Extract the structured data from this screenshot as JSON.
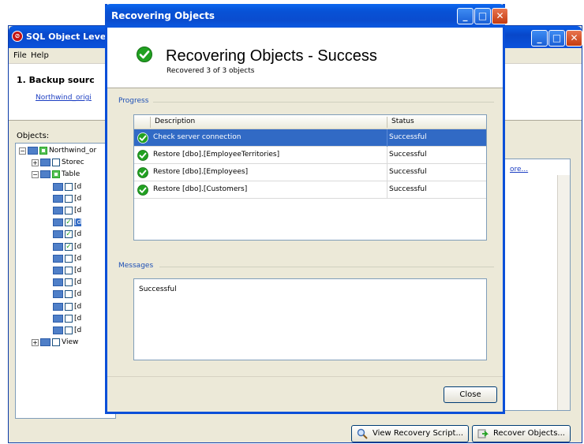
{
  "background_window": {
    "title": "SQL Object Leve",
    "logo": "app-logo-icon",
    "menu": [
      "File",
      "Help"
    ],
    "step_title": "1. Backup sourc",
    "step_link": "Northwind_origi",
    "objects_label": "Objects:",
    "tree": [
      {
        "text": "Northwind_or",
        "level": 0,
        "expander": "-",
        "checked": "green"
      },
      {
        "text": "Storec",
        "level": 1,
        "expander": "+",
        "checked": "none"
      },
      {
        "text": "Table",
        "level": 1,
        "expander": "-",
        "checked": "green"
      },
      {
        "text": "[d",
        "level": 2,
        "checked": "none"
      },
      {
        "text": "[d",
        "level": 2,
        "checked": "none"
      },
      {
        "text": "[d",
        "level": 2,
        "checked": "none"
      },
      {
        "text": "[d",
        "level": 2,
        "checked": "checked",
        "selected": true
      },
      {
        "text": "[d",
        "level": 2,
        "checked": "checked"
      },
      {
        "text": "[d",
        "level": 2,
        "checked": "checked"
      },
      {
        "text": "[d",
        "level": 2,
        "checked": "none"
      },
      {
        "text": "[d",
        "level": 2,
        "checked": "none"
      },
      {
        "text": "[d",
        "level": 2,
        "checked": "none"
      },
      {
        "text": "[d",
        "level": 2,
        "checked": "none"
      },
      {
        "text": "[d",
        "level": 2,
        "checked": "none"
      },
      {
        "text": "[d",
        "level": 2,
        "checked": "none"
      },
      {
        "text": "[d",
        "level": 2,
        "checked": "none"
      },
      {
        "text": "View",
        "level": 1,
        "expander": "+",
        "checked": "none"
      }
    ],
    "more_link": "ore...",
    "buttons": {
      "view_script": "View Recovery Script...",
      "recover": "Recover Objects..."
    }
  },
  "dialog": {
    "title": "Recovering Objects",
    "heading": "Recovering Objects - Success",
    "subheading": "Recovered 3 of 3 objects",
    "progress_label": "Progress",
    "columns": [
      "Description",
      "Status"
    ],
    "rows": [
      {
        "description": "Check server connection",
        "status": "Successful",
        "selected": true
      },
      {
        "description": "Restore [dbo].[EmployeeTerritories]",
        "status": "Successful"
      },
      {
        "description": "Restore [dbo].[Employees]",
        "status": "Successful"
      },
      {
        "description": "Restore [dbo].[Customers]",
        "status": "Successful"
      }
    ],
    "messages_label": "Messages",
    "messages_text": "Successful",
    "close_label": "Close"
  },
  "colors": {
    "titlebar": "#0a4ccf",
    "selection": "#316ac5",
    "success": "#21a121"
  }
}
